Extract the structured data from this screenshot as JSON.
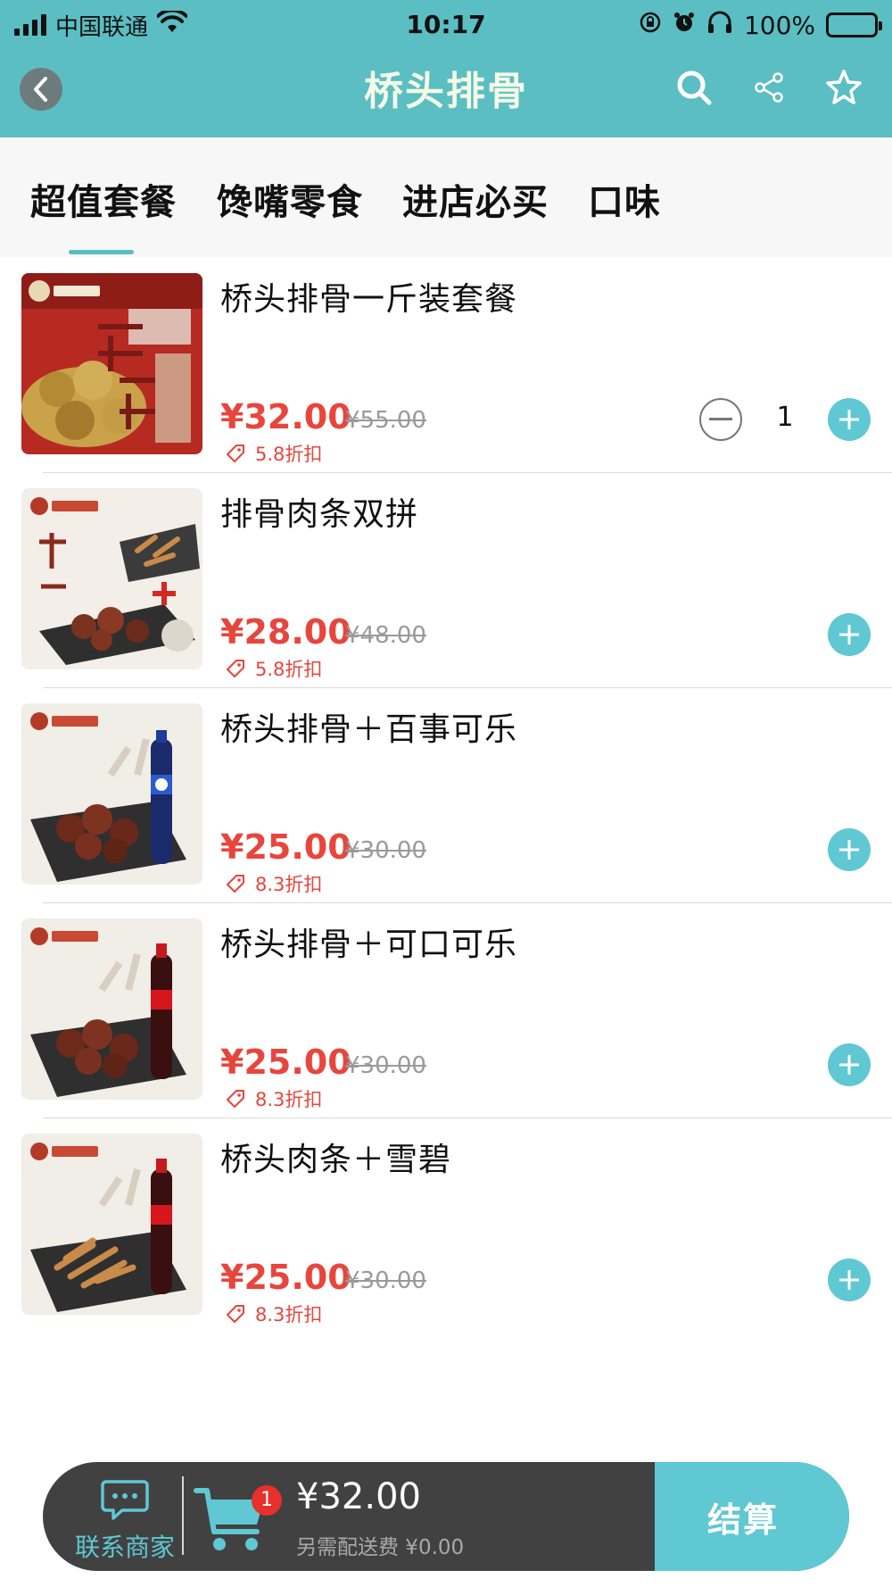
{
  "status_bar": {
    "carrier": "中国联通",
    "time": "10:17",
    "battery_percent": "100%",
    "battery_level": 1.0
  },
  "nav": {
    "title": "桥头排骨",
    "icons": [
      "back-arrow-icon",
      "search-icon",
      "share-icon",
      "star-icon"
    ]
  },
  "tabs": {
    "items": [
      {
        "label": "超值套餐",
        "active": true
      },
      {
        "label": "馋嘴零食",
        "active": false
      },
      {
        "label": "进店必买",
        "active": false
      },
      {
        "label": "口味",
        "active": false
      }
    ],
    "accent_color": "#5bbec3"
  },
  "products": [
    {
      "name": "桥头排骨一斤装套餐",
      "price": "¥32.00",
      "original_price": "¥55.00",
      "discount": "5.8折扣",
      "quantity": "1",
      "image_icon": "ribs-combo-image"
    },
    {
      "name": "排骨肉条双拼",
      "price": "¥28.00",
      "original_price": "¥48.00",
      "discount": "5.8折扣",
      "image_icon": "ribs-strips-image"
    },
    {
      "name": "桥头排骨＋百事可乐",
      "price": "¥25.00",
      "original_price": "¥30.00",
      "discount": "8.3折扣",
      "image_icon": "ribs-pepsi-image"
    },
    {
      "name": "桥头排骨＋可口可乐",
      "price": "¥25.00",
      "original_price": "¥30.00",
      "discount": "8.3折扣",
      "image_icon": "ribs-cola-image"
    },
    {
      "name": "桥头肉条＋雪碧",
      "price": "¥25.00",
      "original_price": "¥30.00",
      "discount": "8.3折扣",
      "image_icon": "strips-sprite-image"
    }
  ],
  "cart": {
    "contact_label": "联系商家",
    "badge_count": "1",
    "total": "¥32.00",
    "delivery_note": "另需配送费 ¥0.00",
    "checkout_label": "结算"
  },
  "colors": {
    "theme": "#5bbec3",
    "price_red": "#e8453c",
    "cart_bar": "#414141",
    "button_teal": "#5fc8d3"
  }
}
